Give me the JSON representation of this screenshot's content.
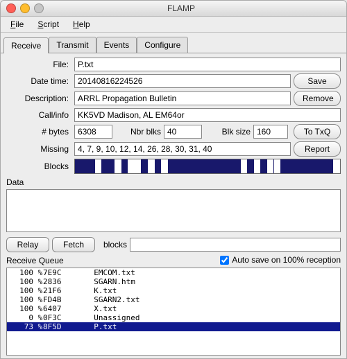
{
  "window": {
    "title": "FLAMP"
  },
  "menu": {
    "file": "File",
    "script": "Script",
    "help": "Help"
  },
  "tabs": {
    "receive": "Receive",
    "transmit": "Transmit",
    "events": "Events",
    "configure": "Configure"
  },
  "labels": {
    "file": "File:",
    "datetime": "Date time:",
    "description": "Description:",
    "callinfo": "Call/info",
    "nbytes": "# bytes",
    "nbrblks": "Nbr blks",
    "blksize": "Blk size",
    "missing": "Missing",
    "blocks": "Blocks",
    "data": "Data",
    "blocks2": "blocks",
    "recvqueue": "Receive Queue"
  },
  "buttons": {
    "save": "Save",
    "remove": "Remove",
    "totxq": "To TxQ",
    "report": "Report",
    "relay": "Relay",
    "fetch": "Fetch"
  },
  "fields": {
    "file": "P.txt",
    "datetime": "20140816224526",
    "description": "ARRL Propagation Bulletin",
    "callinfo": "KK5VD Madison, AL EM64or",
    "nbytes": "6308",
    "nbrblks": "40",
    "blksize": "160",
    "missing": "4, 7, 9, 10, 12, 14, 26, 28, 30, 31, 40",
    "data": "",
    "relay_blocks": ""
  },
  "autosave": {
    "checked": true,
    "label": "Auto save on 100% reception"
  },
  "blocks_vis": {
    "total": 40,
    "missing": [
      4,
      7,
      9,
      10,
      12,
      14,
      26,
      28,
      30,
      31,
      40
    ]
  },
  "queue": [
    {
      "pct": "100",
      "sym": "%",
      "id": "7E9C",
      "name": "EMCOM.txt",
      "selected": false
    },
    {
      "pct": "100",
      "sym": "%",
      "id": "2836",
      "name": "SGARN.htm",
      "selected": false
    },
    {
      "pct": "100",
      "sym": "%",
      "id": "21F6",
      "name": "K.txt",
      "selected": false
    },
    {
      "pct": "100",
      "sym": "%",
      "id": "FD4B",
      "name": "SGARN2.txt",
      "selected": false
    },
    {
      "pct": "100",
      "sym": "%",
      "id": "6407",
      "name": "X.txt",
      "selected": false
    },
    {
      "pct": "0",
      "sym": "%",
      "id": "0F3C",
      "name": "Unassigned",
      "selected": false
    },
    {
      "pct": "73",
      "sym": "%",
      "id": "8F5D",
      "name": "P.txt",
      "selected": true
    }
  ]
}
